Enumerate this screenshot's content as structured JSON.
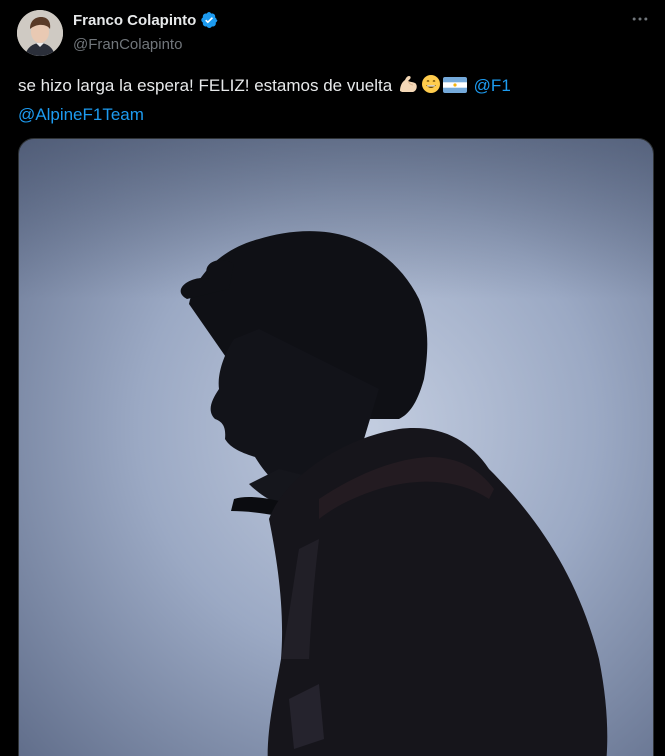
{
  "author": {
    "display_name": "Franco Colapinto",
    "handle": "@FranColapinto",
    "verified": true,
    "verified_color": "#1d9bf0"
  },
  "tweet": {
    "text": "se hizo larga la espera! FELIZ! estamos de vuelta",
    "emojis": [
      "flexed-biceps-emoji",
      "grinning-face-emoji",
      "argentina-flag-emoji"
    ],
    "mentions": [
      "@F1",
      "@AlpineF1Team"
    ]
  },
  "media": {
    "type": "photo",
    "description_icon": "silhouette-photo"
  },
  "colors": {
    "background": "#000000",
    "text": "#e7e9ea",
    "secondary": "#71767b",
    "link": "#1d9bf0"
  }
}
